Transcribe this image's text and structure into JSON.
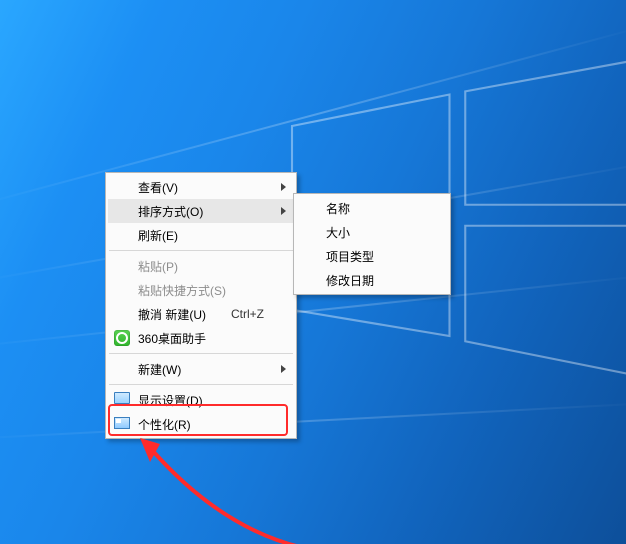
{
  "context_menu": {
    "view": {
      "label": "查看(V)"
    },
    "sort": {
      "label": "排序方式(O)"
    },
    "refresh": {
      "label": "刷新(E)"
    },
    "paste": {
      "label": "粘贴(P)"
    },
    "paste_shortcut": {
      "label": "粘贴快捷方式(S)"
    },
    "undo_new": {
      "label": "撤消 新建(U)",
      "shortcut": "Ctrl+Z"
    },
    "helper360": {
      "label": "360桌面助手"
    },
    "new": {
      "label": "新建(W)"
    },
    "display_settings": {
      "label": "显示设置(D)"
    },
    "personalize": {
      "label": "个性化(R)"
    }
  },
  "sort_submenu": {
    "name": {
      "label": "名称"
    },
    "size": {
      "label": "大小"
    },
    "type": {
      "label": "项目类型"
    },
    "date": {
      "label": "修改日期"
    }
  }
}
